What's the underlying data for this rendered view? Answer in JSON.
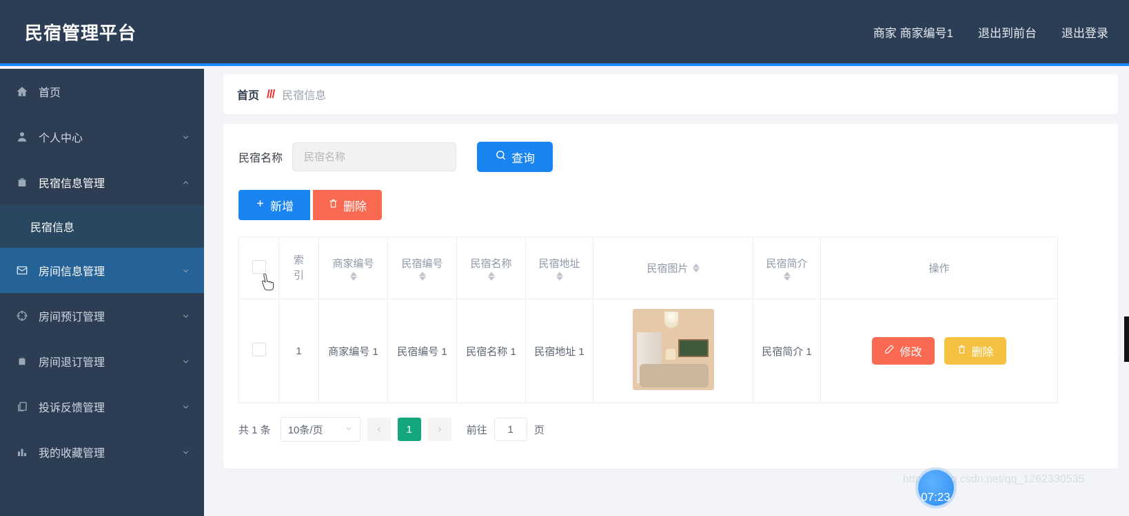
{
  "header": {
    "brand": "民宿管理平台",
    "user": "商家 商家编号1",
    "exit_front": "退出到前台",
    "logout": "退出登录"
  },
  "sidebar": {
    "items": [
      {
        "label": "首页",
        "icon": "home-icon",
        "chevron": ""
      },
      {
        "label": "个人中心",
        "icon": "user-icon",
        "chevron": "⌄"
      },
      {
        "label": "民宿信息管理",
        "icon": "briefcase-icon",
        "chevron": "⌃"
      },
      {
        "label": "房间信息管理",
        "icon": "envelope-icon",
        "chevron": "⌄"
      },
      {
        "label": "房间预订管理",
        "icon": "compass-icon",
        "chevron": "⌄"
      },
      {
        "label": "房间退订管理",
        "icon": "suitcase-icon",
        "chevron": "⌄"
      },
      {
        "label": "投诉反馈管理",
        "icon": "copy-icon",
        "chevron": "⌄"
      },
      {
        "label": "我的收藏管理",
        "icon": "bar-chart-icon",
        "chevron": "⌄"
      }
    ],
    "sub_item": "民宿信息"
  },
  "breadcrumb": {
    "home": "首页",
    "separator": "///",
    "current": "民宿信息"
  },
  "search": {
    "label": "民宿名称",
    "placeholder": "民宿名称",
    "value": "",
    "query_button": "查询",
    "query_icon": "search-icon"
  },
  "toolbar": {
    "add_label": "新增",
    "add_icon": "plus-icon",
    "delete_label": "删除",
    "delete_icon": "trash-icon"
  },
  "table": {
    "columns": [
      {
        "label": "",
        "sortable": false,
        "type": "checkbox"
      },
      {
        "label": "索 引",
        "sortable": false
      },
      {
        "label": "商家编号",
        "sortable": true
      },
      {
        "label": "民宿编号",
        "sortable": true
      },
      {
        "label": "民宿名称",
        "sortable": true
      },
      {
        "label": "民宿地址",
        "sortable": true
      },
      {
        "label": "民宿图片",
        "sortable": true
      },
      {
        "label": "民宿简介",
        "sortable": true
      },
      {
        "label": "操作",
        "sortable": false
      }
    ],
    "rows": [
      {
        "index": "1",
        "merchant_no": "商家编号 1",
        "house_no": "民宿编号 1",
        "house_name": "民宿名称 1",
        "house_address": "民宿地址 1",
        "house_image": "living-room-photo",
        "house_intro": "民宿简介 1",
        "edit_label": "修改",
        "edit_icon": "pencil-icon",
        "delete_label": "删除",
        "delete_icon": "trash-icon"
      }
    ]
  },
  "pagination": {
    "total_text": "共 1 条",
    "page_size": "10条/页",
    "prev_icon": "chevron-left-icon",
    "next_icon": "chevron-right-icon",
    "current_page": "1",
    "goto_label": "前往",
    "goto_value": "1",
    "page_unit": "页"
  },
  "overlay": {
    "clock": "07:23",
    "watermark": "https://blog.csdn.net/qq_1262330535"
  },
  "colors": {
    "header_bg": "#2c3e55",
    "accent_blue": "#1a85f0",
    "danger_red": "#fa6a53",
    "warning_yellow": "#f5c141",
    "page_active_green": "#13a67f"
  }
}
